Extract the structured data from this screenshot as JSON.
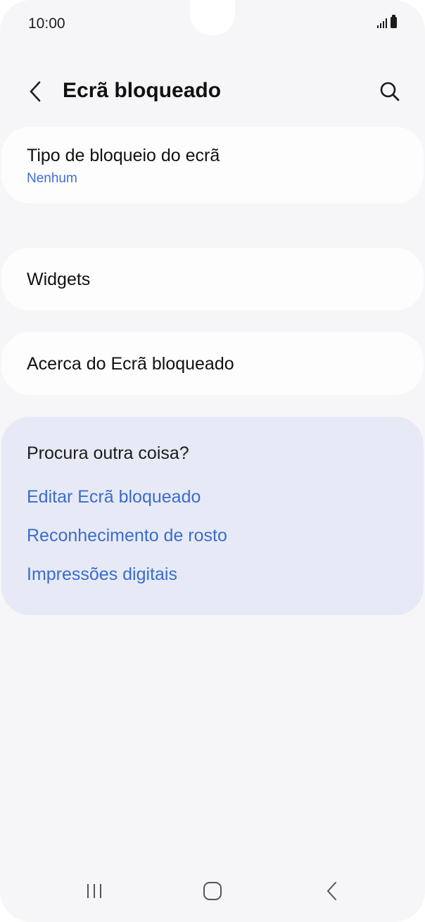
{
  "status_bar": {
    "time": "10:00"
  },
  "app_bar": {
    "title": "Ecrã bloqueado"
  },
  "settings": {
    "lock_type": {
      "label": "Tipo de bloqueio do ecrã",
      "value": "Nenhum"
    },
    "widgets": {
      "label": "Widgets"
    },
    "about": {
      "label": "Acerca do Ecrã bloqueado"
    }
  },
  "suggestions": {
    "title": "Procura outra coisa?",
    "links": [
      "Editar Ecrã bloqueado",
      "Reconhecimento de rosto",
      "Impressões digitais"
    ]
  },
  "colors": {
    "accent": "#3a6ccc",
    "background": "#f6f6f8",
    "suggest_bg": "#e7eaf6"
  }
}
